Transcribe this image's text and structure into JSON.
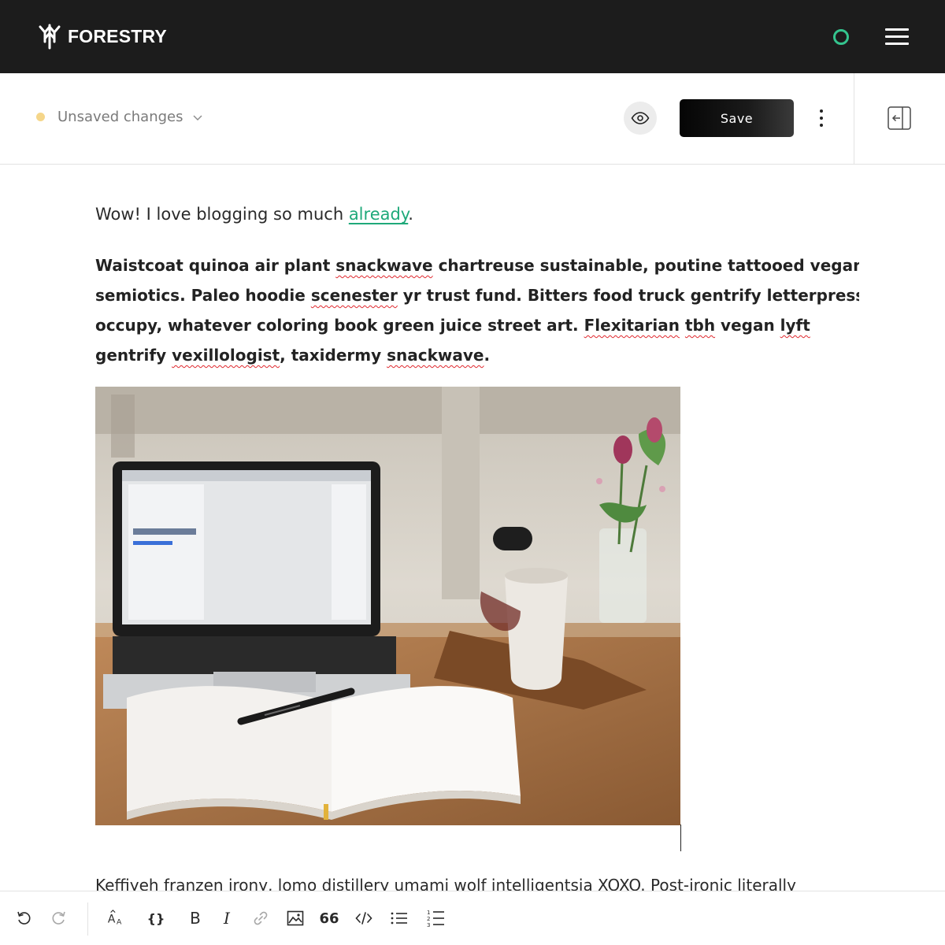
{
  "app": {
    "name": "FORESTRY",
    "accent_color": "#34c48e"
  },
  "editor_header": {
    "status_text": "Unsaved changes",
    "status_color": "#f5d68a",
    "save_label": "Save",
    "icons": [
      "chevron-down-icon",
      "eye-icon",
      "more-vertical-icon",
      "sidebar-collapse-icon"
    ]
  },
  "content": {
    "intro_text": "Wow! I love blogging so much ",
    "intro_link": "already",
    "intro_end": ".",
    "paragraph_lines": [
      [
        {
          "t": "Waistcoat quinoa air plant "
        },
        {
          "t": "snackwave",
          "sp": true
        },
        {
          "t": " chartreuse sustainable, poutine tattooed vegan"
        }
      ],
      [
        {
          "t": "semiotics. Paleo hoodie "
        },
        {
          "t": "scenester",
          "sp": true
        },
        {
          "t": " yr trust fund. Bitters food truck gentrify letterpress"
        }
      ],
      [
        {
          "t": "occupy, whatever coloring book green juice street art. "
        },
        {
          "t": "Flexitarian",
          "sp": true
        },
        {
          "t": " "
        },
        {
          "t": "tbh",
          "sp": true
        },
        {
          "t": " vegan "
        },
        {
          "t": "lyft",
          "sp": true
        }
      ],
      [
        {
          "t": "gentrify "
        },
        {
          "t": "vexillologist",
          "sp": true
        },
        {
          "t": ", taxidermy "
        },
        {
          "t": "snackwave",
          "sp": true
        },
        {
          "t": "."
        }
      ]
    ],
    "next_paragraph": "Keffiyeh franzen irony, lomo distillery umami wolf intelligentsia XOXO. Post-ironic literally"
  },
  "toolbar": {
    "undo": "undo-icon",
    "redo": "redo-icon",
    "heading": "text-size-icon",
    "shortcode_label": "{}",
    "bold_label": "B",
    "italic_label": "I",
    "link": "link-icon",
    "image": "image-icon",
    "quote_label": "66",
    "code": "code-icon",
    "bullet_list": "bulleted-list-icon",
    "numbered_list": "numbered-list-icon"
  }
}
